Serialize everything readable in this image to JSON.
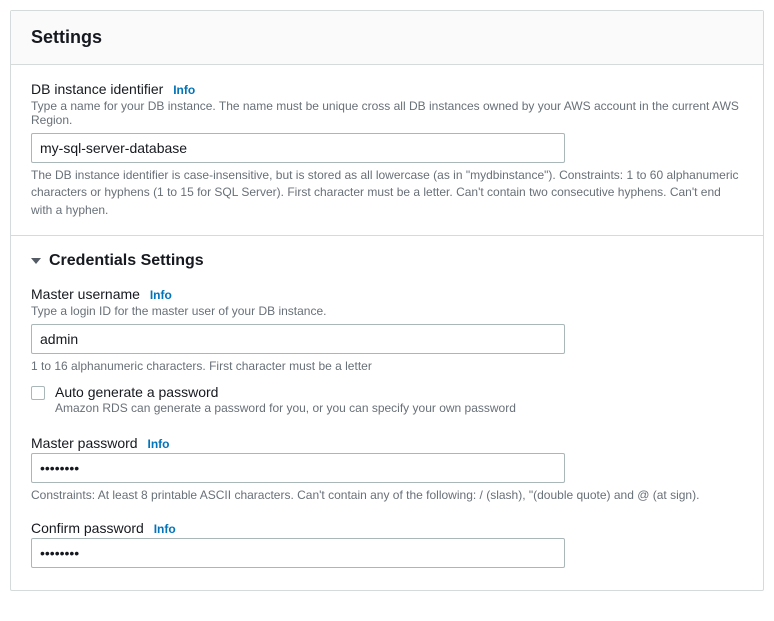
{
  "panel": {
    "title": "Settings"
  },
  "db_identifier": {
    "label": "DB instance identifier",
    "info": "Info",
    "description": "Type a name for your DB instance. The name must be unique cross all DB instances owned by your AWS account in the current AWS Region.",
    "value": "my-sql-server-database",
    "constraint": "The DB instance identifier is case-insensitive, but is stored as all lowercase (as in \"mydbinstance\"). Constraints: 1 to 60 alphanumeric characters or hyphens (1 to 15 for SQL Server). First character must be a letter. Can't contain two consecutive hyphens. Can't end with a hyphen."
  },
  "credentials": {
    "section_title": "Credentials Settings",
    "master_username": {
      "label": "Master username",
      "info": "Info",
      "description": "Type a login ID for the master user of your DB instance.",
      "value": "admin",
      "constraint": "1 to 16 alphanumeric characters. First character must be a letter"
    },
    "auto_generate": {
      "label": "Auto generate a password",
      "description": "Amazon RDS can generate a password for you, or you can specify your own password",
      "checked": false
    },
    "master_password": {
      "label": "Master password",
      "info": "Info",
      "value": "••••••••",
      "constraint": "Constraints: At least 8 printable ASCII characters. Can't contain any of the following: / (slash), \"(double quote) and @ (at sign)."
    },
    "confirm_password": {
      "label": "Confirm password",
      "info": "Info",
      "value": "••••••••"
    }
  }
}
